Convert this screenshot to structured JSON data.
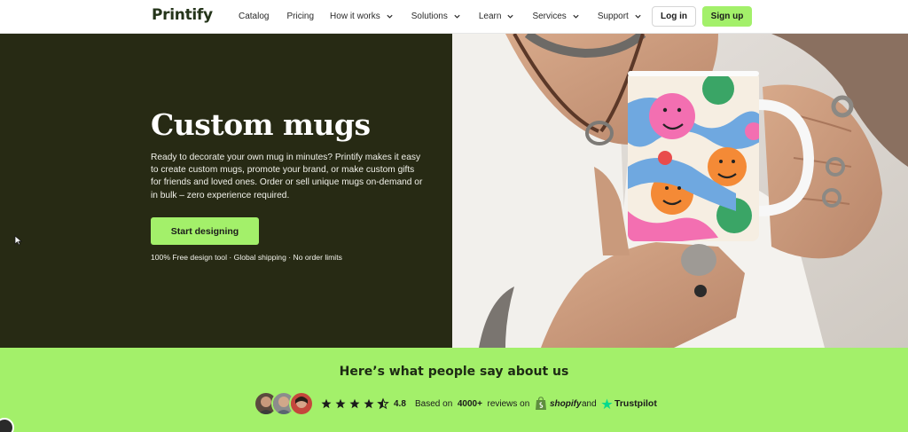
{
  "nav": {
    "logo": "Printify",
    "links": [
      {
        "label": "Catalog",
        "dropdown": false
      },
      {
        "label": "Pricing",
        "dropdown": false
      },
      {
        "label": "How it works",
        "dropdown": true
      },
      {
        "label": "Solutions",
        "dropdown": true
      },
      {
        "label": "Learn",
        "dropdown": true
      },
      {
        "label": "Services",
        "dropdown": true
      },
      {
        "label": "Support",
        "dropdown": true
      }
    ],
    "login_label": "Log in",
    "signup_label": "Sign up"
  },
  "hero": {
    "title": "Custom mugs",
    "description": "Ready to decorate your own mug in minutes? Printify makes it easy to create custom mugs, promote your brand, or make custom gifts for friends and loved ones. Order or sell unique mugs on-demand or in bulk – zero experience required.",
    "cta_label": "Start designing",
    "note": "100% Free design tool · Global shipping · No order limits",
    "image_icon": "mug-photo"
  },
  "reviews": {
    "title": "Here’s what people say about us",
    "rating_value": 4.8,
    "rating": "4.8",
    "based_on": "Based on",
    "count": "4000+",
    "reviews_on": "reviews on",
    "shopify": "shopify",
    "and": "and",
    "trustpilot": "Trustpilot",
    "star_count": 5,
    "avatars": [
      "reviewer-1",
      "reviewer-2",
      "reviewer-3"
    ]
  },
  "colors": {
    "accent": "#a3f06a",
    "hero_bg": "#272a14",
    "trustpilot_star": "#04da8d"
  }
}
